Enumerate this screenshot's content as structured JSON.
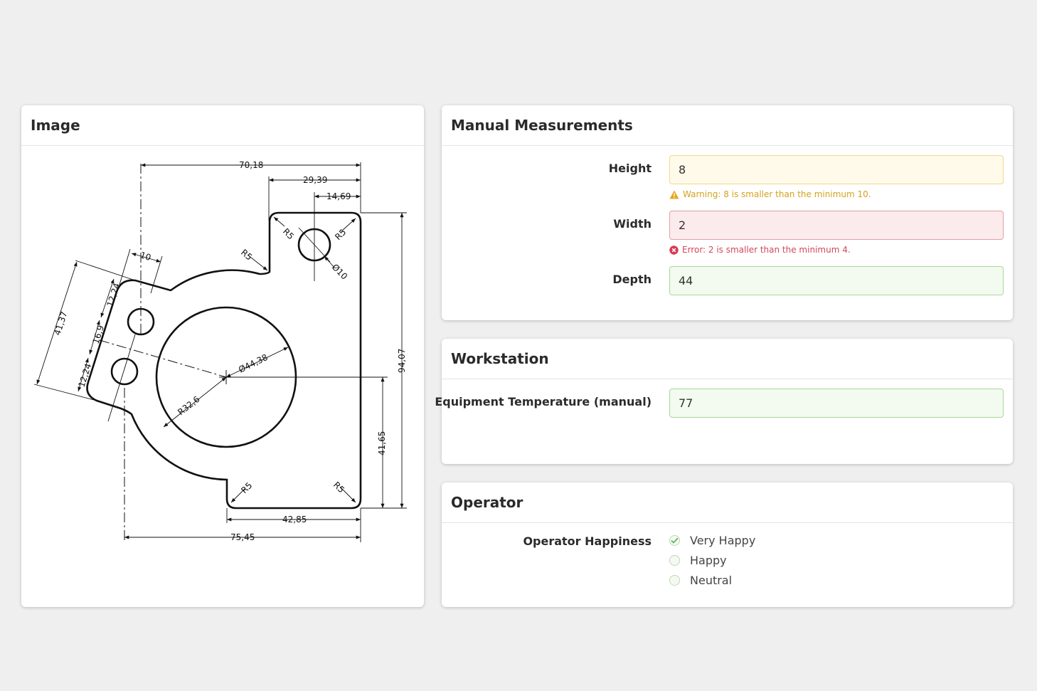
{
  "image_panel": {
    "title": "Image"
  },
  "drawing": {
    "dims": {
      "d1": "70,18",
      "d2": "29,39",
      "d3": "14,69",
      "d4": "10",
      "d5": "41,37",
      "d6": "12,24",
      "d7": "16,9",
      "d8": "12,24",
      "d9": "94,07",
      "d10": "41,65",
      "d11": "42,85",
      "d12": "75,45",
      "r1": "R5",
      "r2": "R5",
      "r3": "R5",
      "r4": "R5",
      "r5": "R5",
      "dia_small": "Ø10",
      "dia_big": "Ø44,38",
      "r_big": "R32,6"
    }
  },
  "measurements": {
    "title": "Manual Measurements",
    "height": {
      "label": "Height",
      "value": "8",
      "message": "Warning: 8 is smaller than the minimum 10."
    },
    "width": {
      "label": "Width",
      "value": "2",
      "message": "Error: 2 is smaller than the minimum 4."
    },
    "depth": {
      "label": "Depth",
      "value": "44"
    }
  },
  "workstation": {
    "title": "Workstation",
    "temperature": {
      "label": "Equipment Temperature (manual)",
      "value": "77"
    }
  },
  "operator": {
    "title": "Operator",
    "happiness": {
      "label": "Operator Happiness",
      "options": [
        "Very Happy",
        "Happy",
        "Neutral"
      ],
      "selected": "Very Happy"
    }
  },
  "colors": {
    "warning": "#d4a21c",
    "error": "#d2475c",
    "success": "#5cb85c"
  }
}
